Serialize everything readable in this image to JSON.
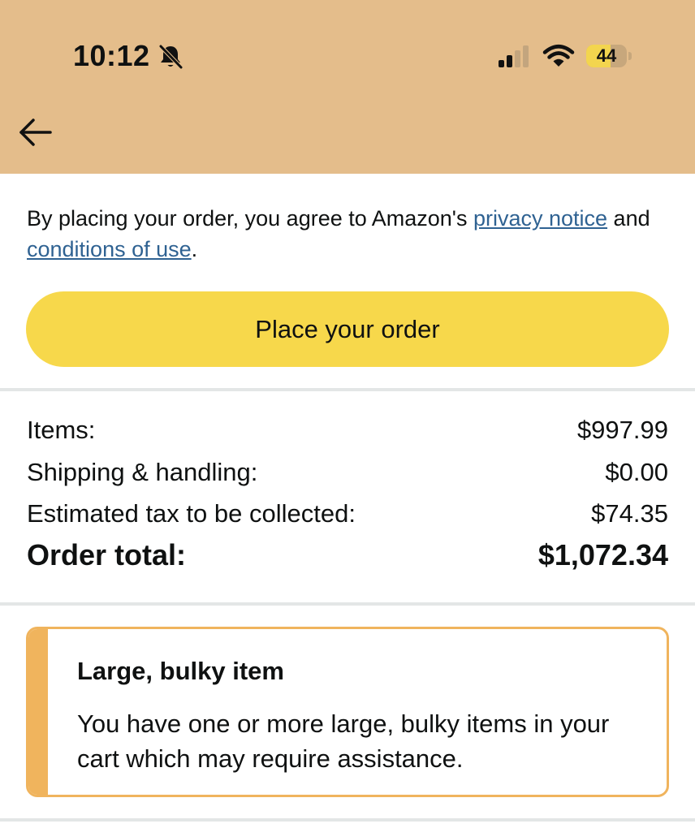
{
  "status_bar": {
    "time": "10:12",
    "battery_level": "44",
    "battery_fill_percent": 0.6,
    "icons": [
      "bell-slash-icon",
      "cellular-signal-icon",
      "wifi-icon",
      "battery-icon"
    ]
  },
  "header": {
    "background_color": "#e4bd8b",
    "back_icon": "arrow-left-icon"
  },
  "agreement": {
    "prefix": "By placing your order, you agree to Amazon's ",
    "privacy_link": "privacy notice",
    "middle": " and ",
    "conditions_link": "conditions of use",
    "suffix": ".",
    "link_color": "#2f6292"
  },
  "place_order": {
    "label": "Place your order",
    "color": "#f7d84b"
  },
  "summary": {
    "items": {
      "label": "Items:",
      "value": "$997.99"
    },
    "shipping": {
      "label": "Shipping & handling:",
      "value": "$0.00"
    },
    "tax": {
      "label": "Estimated tax to be collected:",
      "value": "$74.35"
    },
    "total": {
      "label": "Order total:",
      "value": "$1,072.34"
    }
  },
  "notice": {
    "title": "Large, bulky item",
    "body": "You have one or more large, bulky items in your cart which may require assistance.",
    "accent_color": "#f0b45d"
  }
}
